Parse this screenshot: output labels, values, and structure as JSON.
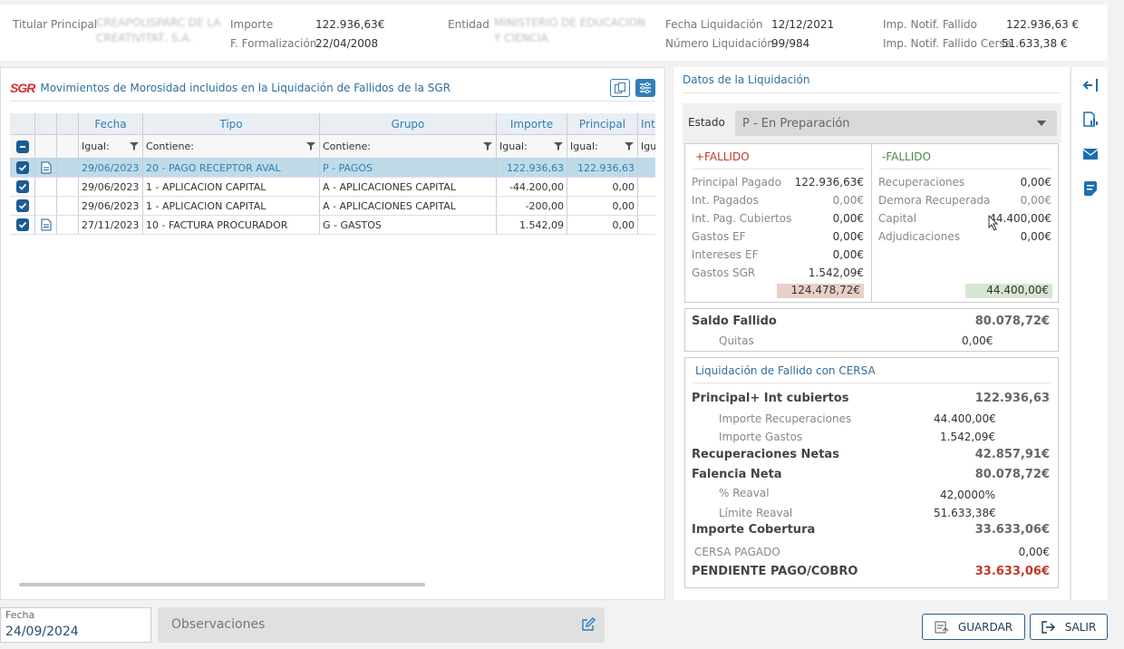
{
  "header": {
    "titular_label": "Titular Principal",
    "titular_value": "CREAPOLISPARC DE LA CREATIVITAT, S.A.",
    "importe_label": "Importe",
    "importe_value": "122.936,63€",
    "formalizacion_label": "F. Formalización",
    "formalizacion_value": "22/04/2008",
    "entidad_label": "Entidad",
    "entidad_value": "MINISTERIO DE EDUCACION Y CIENCIA",
    "fecha_liq_label": "Fecha Liquidación",
    "fecha_liq_value": "12/12/2021",
    "num_liq_label": "Número Liquidación",
    "num_liq_value": "99/984",
    "notif_label": "Imp. Notif. Fallido",
    "notif_value": "122.936,63 €",
    "notif_cersa_label": "Imp. Notif. Fallido Cersa",
    "notif_cersa_value": "51.633,38 €"
  },
  "movimientos": {
    "logo": "SGR",
    "title": "Movimientos de Morosidad incluidos en la Liquidación de Fallidos de la SGR",
    "columns": [
      "Fecha",
      "Tipo",
      "Grupo",
      "Importe",
      "Principal",
      "Int"
    ],
    "filters": [
      "Igual:",
      "Contiene:",
      "Contiene:",
      "Igual:",
      "Igual:",
      "Igu"
    ],
    "rows": [
      {
        "fecha": "29/06/2023",
        "tipo": "20 - PAGO RECEPTOR AVAL",
        "grupo": "P - PAGOS",
        "importe": "122.936,63",
        "principal": "122.936,63"
      },
      {
        "fecha": "29/06/2023",
        "tipo": "1 - APLICACION CAPITAL",
        "grupo": "A - APLICACIONES CAPITAL",
        "importe": "-44.200,00",
        "principal": "0,00"
      },
      {
        "fecha": "29/06/2023",
        "tipo": "1 - APLICACION CAPITAL",
        "grupo": "A - APLICACIONES CAPITAL",
        "importe": "-200,00",
        "principal": "0,00"
      },
      {
        "fecha": "27/11/2023",
        "tipo": "10 - FACTURA PROCURADOR",
        "grupo": "G - GASTOS",
        "importe": "1.542,09",
        "principal": "0,00"
      }
    ]
  },
  "liquidacion": {
    "title": "Datos de la Liquidación",
    "estado_label": "Estado",
    "estado_value": "P - En Preparación",
    "plus_header": "+FALLIDO",
    "minus_header": "-FALLIDO",
    "plus": [
      {
        "label": "Principal Pagado",
        "value": "122.936,63€"
      },
      {
        "label": "Int. Pagados",
        "value": "0,00€"
      },
      {
        "label": "Int. Pag. Cubiertos",
        "value": "0,00€"
      },
      {
        "label": "Gastos EF",
        "value": "0,00€"
      },
      {
        "label": "Intereses EF",
        "value": "0,00€"
      },
      {
        "label": "Gastos SGR",
        "value": "1.542,09€"
      }
    ],
    "minus": [
      {
        "label": "Recuperaciones",
        "value": "0,00€"
      },
      {
        "label": "Demora Recuperada",
        "value": "0,00€"
      },
      {
        "label": "Capital",
        "value": "44.400,00€"
      },
      {
        "label": "Adjudicaciones",
        "value": "0,00€"
      }
    ],
    "plus_total": "124.478,72€",
    "minus_total": "44.400,00€",
    "saldo_label": "Saldo Fallido",
    "saldo_value": "80.078,72€",
    "quitas_label": "Quitas",
    "quitas_value": "0,00€"
  },
  "cersa": {
    "title": "Liquidación de Fallido con CERSA",
    "principal_label": "Principal+ Int cubiertos",
    "principal_value": "122.936,63",
    "imp_recup_label": "Importe Recuperaciones",
    "imp_recup_value": "44.400,00€",
    "imp_gastos_label": "Importe Gastos",
    "imp_gastos_value": "1.542,09€",
    "recup_netas_label": "Recuperaciones Netas",
    "recup_netas_value": "42.857,91€",
    "falencia_label": "Falencia Neta",
    "falencia_value": "80.078,72€",
    "reaval_label": "% Reaval",
    "reaval_value": "42,0000%",
    "limite_label": "Límite Reaval",
    "limite_value": "51.633,38€",
    "cobertura_label": "Importe Cobertura",
    "cobertura_value": "33.633,06€",
    "pagado_label": "CERSA PAGADO",
    "pagado_value": "0,00€",
    "pendiente_label": "PENDIENTE PAGO/COBRO",
    "pendiente_value": "33.633,06€"
  },
  "footer": {
    "fecha_label": "Fecha",
    "fecha_value": "24/09/2024",
    "obs_placeholder": "Observaciones",
    "guardar_label": "GUARDAR",
    "salir_label": "SALIR"
  },
  "colors": {
    "accent": "#2f7fb6",
    "dark": "#1c5c92",
    "danger": "#c0392b"
  }
}
